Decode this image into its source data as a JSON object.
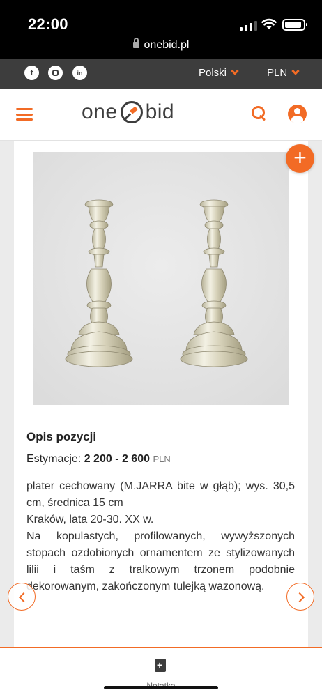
{
  "status_bar": {
    "time": "22:00"
  },
  "browser": {
    "url": "onebid.pl"
  },
  "topbar": {
    "language": "Polski",
    "currency": "PLN"
  },
  "header": {
    "logo_left": "one",
    "logo_right": "bid"
  },
  "lot": {
    "section_title": "Opis pozycji",
    "estimate_label": "Estymacje:",
    "estimate_value": "2 200 - 2 600",
    "estimate_currency": "PLN",
    "description": [
      "plater cechowany (M.JARRA bite w głąb); wys. 30,5 cm, średnica 15 cm",
      "Kraków, lata 20-30. XX w.",
      "Na kopulastych, profilowanych, wywyższonych stopach ozdobionych ornamentem ze stylizowanych lilii i taśm z tralkowym trzonem podobnie dekorowanym, zakończonym tulejką wazonową."
    ]
  },
  "bottom_bar": {
    "note_label": "Notatka"
  },
  "colors": {
    "accent": "#f26b25",
    "dark_bar": "#3d3d3d"
  }
}
